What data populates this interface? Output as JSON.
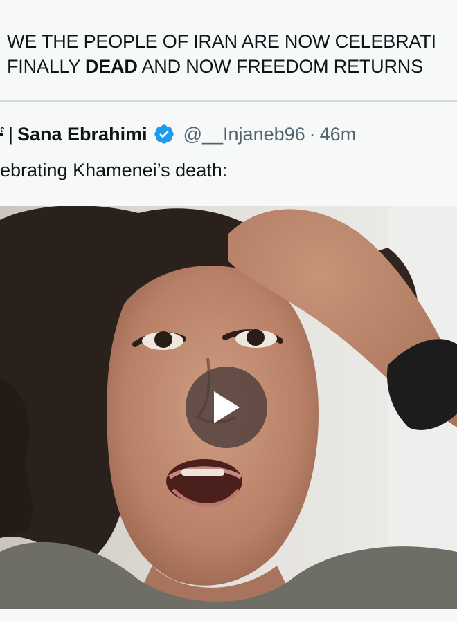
{
  "post": {
    "line1": "WE THE PEOPLE OF IRAN ARE NOW CELEBRATI",
    "line2_before": "FINALLY ",
    "line2_bold": "DEAD",
    "line2_after": " AND NOW FREEDOM RETURNS"
  },
  "quote": {
    "separator": "|",
    "author_name": "Sana Ebrahimi",
    "verified_icon": "verified-badge-icon",
    "handle": "@__Injaneb96",
    "time_separator": "·",
    "timestamp": "46m",
    "text": "ebrating Khamenei’s death:"
  },
  "media": {
    "type": "video",
    "play_icon": "play-icon"
  },
  "colors": {
    "verified": "#1d9bf0",
    "secondary_text": "#536471",
    "divider": "#cfd9de"
  }
}
